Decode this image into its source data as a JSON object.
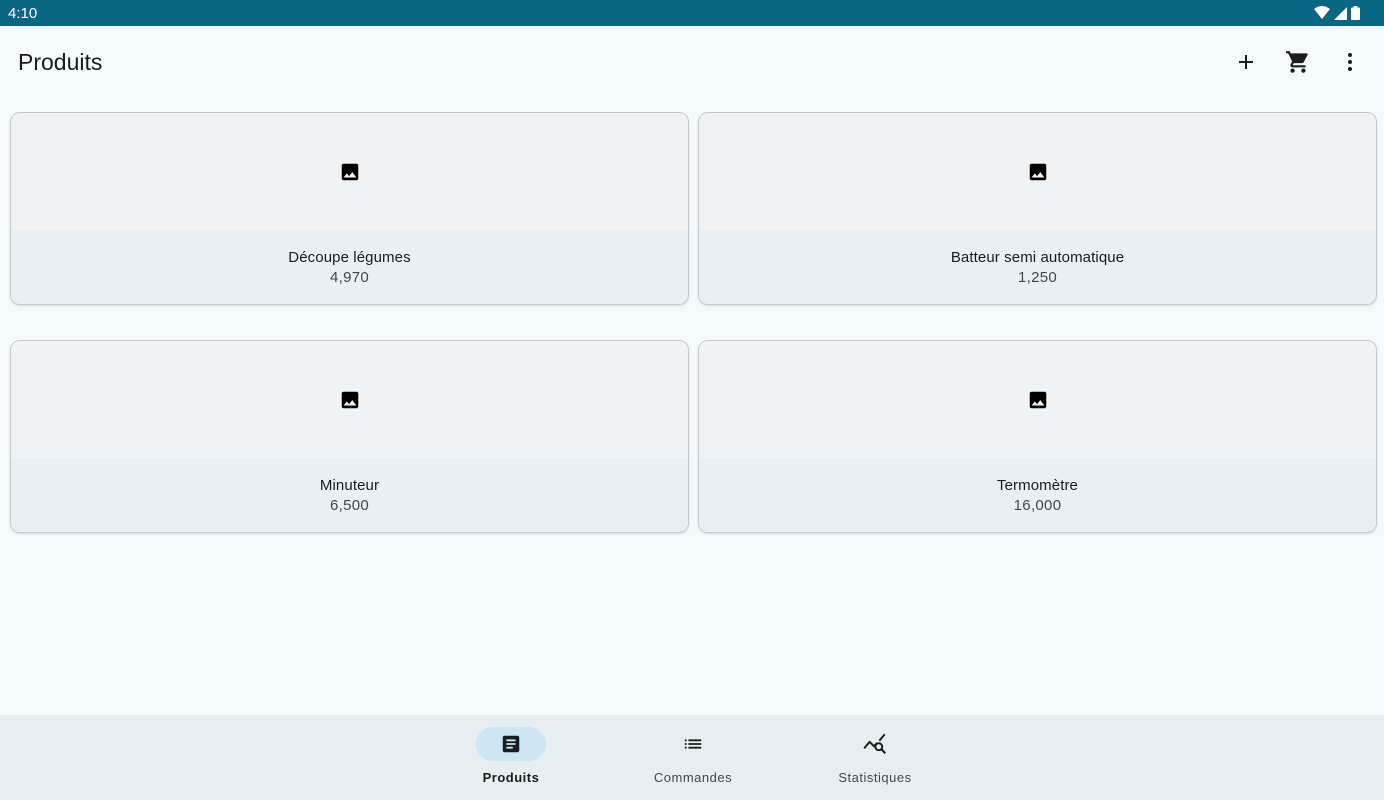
{
  "status_bar": {
    "time": "4:10",
    "icons": [
      "wifi-icon",
      "cell-signal-icon",
      "battery-icon"
    ]
  },
  "top_bar": {
    "title": "Produits",
    "actions": [
      "add-icon",
      "cart-icon",
      "more-vert-icon"
    ]
  },
  "products": [
    {
      "name": "Découpe légumes",
      "price": "4,970",
      "image_icon": "image-placeholder-icon"
    },
    {
      "name": "Batteur semi automatique",
      "price": "1,250",
      "image_icon": "image-placeholder-icon"
    },
    {
      "name": "Minuteur",
      "price": "6,500",
      "image_icon": "image-placeholder-icon"
    },
    {
      "name": "Termomètre",
      "price": "16,000",
      "image_icon": "image-placeholder-icon"
    }
  ],
  "bottom_nav": {
    "items": [
      {
        "label": "Produits",
        "icon": "article-icon",
        "active": true
      },
      {
        "label": "Commandes",
        "icon": "list-icon",
        "active": false
      },
      {
        "label": "Statistiques",
        "icon": "query-stats-icon",
        "active": false
      }
    ]
  },
  "colors": {
    "status_bar": "#0a6682",
    "background": "#f4f9fc",
    "card_image_bg": "#f0f2f4",
    "card_body_bg": "#e8eff5",
    "nav_bg": "#e7eef2",
    "nav_active_pill": "#cde6f3"
  }
}
